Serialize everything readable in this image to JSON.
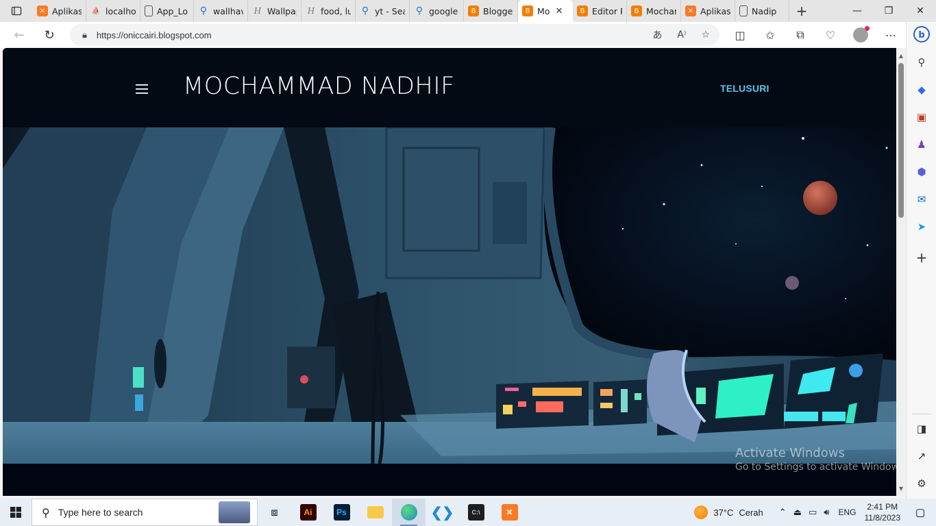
{
  "browser": {
    "tabs": [
      {
        "label": "Aplikasi",
        "icon": "xampp-icon"
      },
      {
        "label": "localhos",
        "icon": "phpmyadmin-icon"
      },
      {
        "label": "App_Lo",
        "icon": "document-icon"
      },
      {
        "label": "wallhav",
        "icon": "search-icon"
      },
      {
        "label": "Wallpap",
        "icon": "font-icon"
      },
      {
        "label": "food, lu",
        "icon": "font-icon"
      },
      {
        "label": "yt - Sea",
        "icon": "search-icon"
      },
      {
        "label": "google",
        "icon": "search-icon"
      },
      {
        "label": "Blogger",
        "icon": "blogger-icon"
      },
      {
        "label": "Mo",
        "icon": "blogger-icon",
        "active": true
      },
      {
        "label": "Editor P",
        "icon": "blogger-icon"
      },
      {
        "label": "Mochan",
        "icon": "blogger-icon"
      },
      {
        "label": "Aplikasi",
        "icon": "xampp-icon"
      },
      {
        "label": "Nadip",
        "icon": "document-icon"
      }
    ],
    "url": "https://oniccairi.blogspot.com"
  },
  "page": {
    "site_title": "MOCHAMMAD NADHIF",
    "nav_link": "TELUSURI"
  },
  "watermark": {
    "line1": "Activate Windows",
    "line2": "Go to Settings to activate Windows."
  },
  "taskbar": {
    "search_placeholder": "Type here to search",
    "apps": [
      "illustrator-icon",
      "photoshop-icon",
      "file-explorer-icon",
      "edge-icon",
      "vscode-icon",
      "terminal-icon",
      "xampp-icon"
    ],
    "weather": {
      "temp": "37°C",
      "condition": "Cerah"
    },
    "language": "ENG",
    "time": "2:41 PM",
    "date": "11/8/2023"
  },
  "colors": {
    "header_bg": "#030a13",
    "accent_link": "#5bc4f0",
    "xampp": "#fb7a24",
    "blogger": "#f57d00"
  }
}
